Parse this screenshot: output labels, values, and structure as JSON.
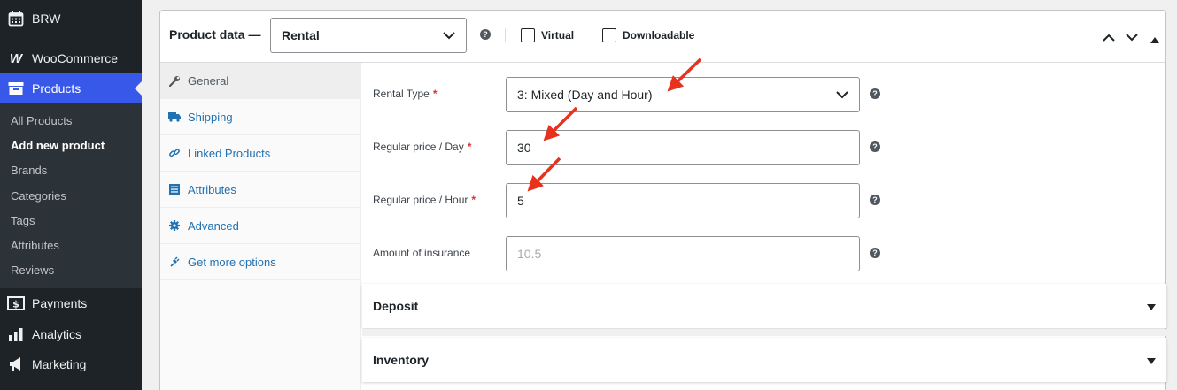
{
  "sidebar": {
    "brw": {
      "label": "BRW",
      "icon": "calendar-icon"
    },
    "woocommerce": {
      "label": "WooCommerce",
      "icon": "woocommerce-icon"
    },
    "products": {
      "label": "Products",
      "icon": "archive-icon"
    },
    "submenu": [
      "All Products",
      "Add new product",
      "Brands",
      "Categories",
      "Tags",
      "Attributes",
      "Reviews"
    ],
    "current_submenu": "Add new product",
    "payments": {
      "label": "Payments",
      "icon": "dollar-icon"
    },
    "analytics": {
      "label": "Analytics",
      "icon": "bar-chart-icon"
    },
    "marketing": {
      "label": "Marketing",
      "icon": "megaphone-icon"
    }
  },
  "product_data": {
    "title": "Product data —",
    "type_value": "Rental",
    "virtual_label": "Virtual",
    "downloadable_label": "Downloadable",
    "virtual_checked": false,
    "downloadable_checked": false
  },
  "tabs": [
    {
      "label": "General",
      "icon": "wrench-icon",
      "active": true
    },
    {
      "label": "Shipping",
      "icon": "truck-icon",
      "active": false
    },
    {
      "label": "Linked Products",
      "icon": "link-icon",
      "active": false
    },
    {
      "label": "Attributes",
      "icon": "list-icon",
      "active": false
    },
    {
      "label": "Advanced",
      "icon": "gear-icon",
      "active": false
    },
    {
      "label": "Get more options",
      "icon": "plugin-icon",
      "active": false
    }
  ],
  "fields": {
    "rental_type": {
      "label": "Rental Type",
      "required": "*",
      "value": "3: Mixed (Day and Hour)"
    },
    "price_day": {
      "label": "Regular price / Day",
      "required": "*",
      "value": "30"
    },
    "price_hour": {
      "label": "Regular price / Hour",
      "required": "*",
      "value": "5"
    },
    "insurance": {
      "label": "Amount of insurance",
      "value": "",
      "placeholder": "10.5"
    }
  },
  "sections": {
    "deposit": "Deposit",
    "inventory": "Inventory"
  },
  "colors": {
    "sidebar_bg": "#1d2327",
    "active_menu": "#3858e9",
    "link": "#2271b1",
    "required": "#d63638",
    "annotation_arrow": "#e8321e"
  }
}
